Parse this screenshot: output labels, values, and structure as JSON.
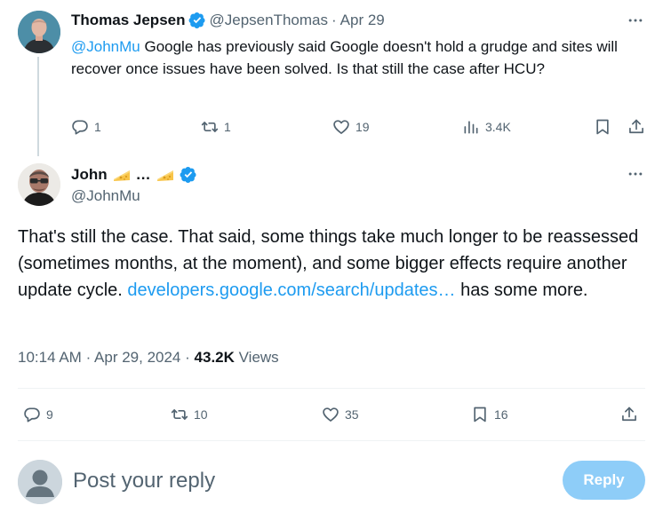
{
  "parent_tweet": {
    "author_name": "Thomas Jepsen",
    "handle": "@JepsenThomas",
    "separator": "·",
    "date": "Apr 29",
    "mention": "@JohnMu",
    "text": " Google has previously said Google doesn't hold a grudge and sites will recover once issues have been solved. Is that still the case after HCU?",
    "metrics": {
      "replies": "1",
      "reposts": "1",
      "likes": "19",
      "views": "3.4K"
    }
  },
  "main_tweet": {
    "author_name_prefix": "John",
    "author_name_middle": "…",
    "handle": "@JohnMu",
    "text_before_link": "That's still the case. That said, some things take much longer to be reassessed (sometimes months, at the moment), and some bigger effects require another update cycle. ",
    "link_text": "developers.google.com/search/updates…",
    "text_after_link": " has some more.",
    "time": "10:14 AM",
    "meta_separator": "·",
    "date": "Apr 29, 2024",
    "views_count": "43.2K",
    "views_label": "Views",
    "metrics": {
      "replies": "9",
      "reposts": "10",
      "likes": "35",
      "bookmarks": "16"
    }
  },
  "reply_box": {
    "placeholder": "Post your reply",
    "button_label": "Reply"
  },
  "colors": {
    "accent": "#1d9bf0",
    "reply_button_disabled": "#8ecdf8",
    "secondary_text": "#536471",
    "primary_text": "#0f1419"
  },
  "icons": {
    "verified": "verified-badge-icon",
    "more": "more-dots-icon",
    "reply": "reply-icon",
    "repost": "repost-icon",
    "like": "heart-icon",
    "views": "views-chart-icon",
    "bookmark": "bookmark-icon",
    "share": "share-icon",
    "cheese": "cheese-emoji-icon"
  }
}
